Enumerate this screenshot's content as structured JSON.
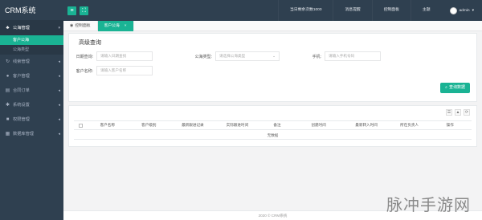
{
  "app": {
    "title": "CRM系统"
  },
  "sidebar": {
    "items": [
      {
        "label": "公海管理",
        "icon": "users-icon",
        "open": true,
        "sub": [
          {
            "label": "客户公海",
            "active": true
          },
          {
            "label": "公海类型",
            "active": false
          }
        ]
      },
      {
        "label": "线索管理",
        "icon": "clue-icon"
      },
      {
        "label": "客户管理",
        "icon": "user-icon"
      },
      {
        "label": "合同订单",
        "icon": "cart-icon"
      },
      {
        "label": "系统设置",
        "icon": "gear-icon"
      },
      {
        "label": "权限管理",
        "icon": "lock-icon"
      },
      {
        "label": "数据库管理",
        "icon": "database-icon"
      }
    ]
  },
  "topbar": {
    "links": [
      "当日剩余次数1000",
      "消息提醒",
      "控制面板",
      "主题"
    ],
    "user": "admin"
  },
  "tabs": [
    {
      "label": "控制面板",
      "active": false
    },
    {
      "label": "客户公海",
      "active": true
    }
  ],
  "search": {
    "title": "高级查询",
    "fields": [
      {
        "label": "日期查询:",
        "placeholder": "请输入日期查找"
      },
      {
        "label": "公海类型:",
        "placeholder": "请选择公海类型",
        "dropdown": true
      },
      {
        "label": "手机:",
        "placeholder": "请输入手机号码"
      },
      {
        "label": "客户名称:",
        "placeholder": "请输入客户名称"
      }
    ],
    "button": "查询数据"
  },
  "table": {
    "columns": [
      "客户名称",
      "客户级别",
      "最新跟进记录",
      "实际跟进时间",
      "备注",
      "创建时间",
      "最新转入时间",
      "所在负责人",
      "操作"
    ],
    "empty_text": "无数据"
  },
  "footer": "2020 © CRM系统",
  "watermark": "脉冲手游网"
}
